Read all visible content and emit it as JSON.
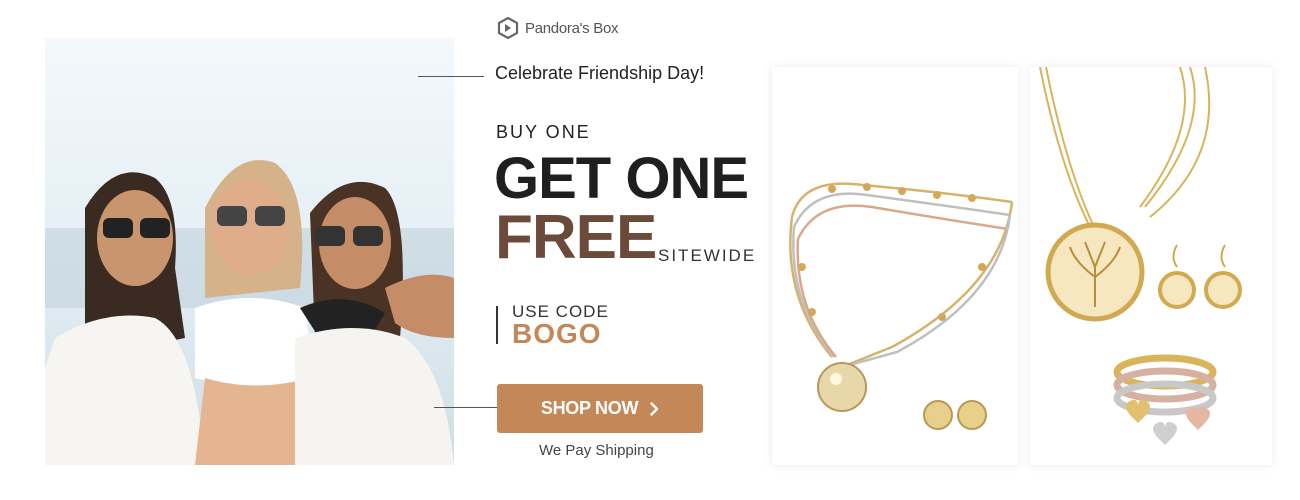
{
  "brand": {
    "name": "Pandora's Box"
  },
  "promo": {
    "tagline": "Celebrate Friendship Day!",
    "buy_one": "BUY ONE",
    "get_one": "GET ONE",
    "free": "FREE",
    "sitewide": "SITEWIDE",
    "use_code_label": "USE CODE",
    "code": "BOGO",
    "cta_label": "SHOP NOW",
    "shipping_note": "We Pay Shipping"
  },
  "colors": {
    "accent": "#c48758",
    "free_text": "#6b4a3a",
    "headline": "#1f1f1f"
  },
  "icons": {
    "logo": "box-logo-icon",
    "cta": "chevron-right-icon"
  }
}
